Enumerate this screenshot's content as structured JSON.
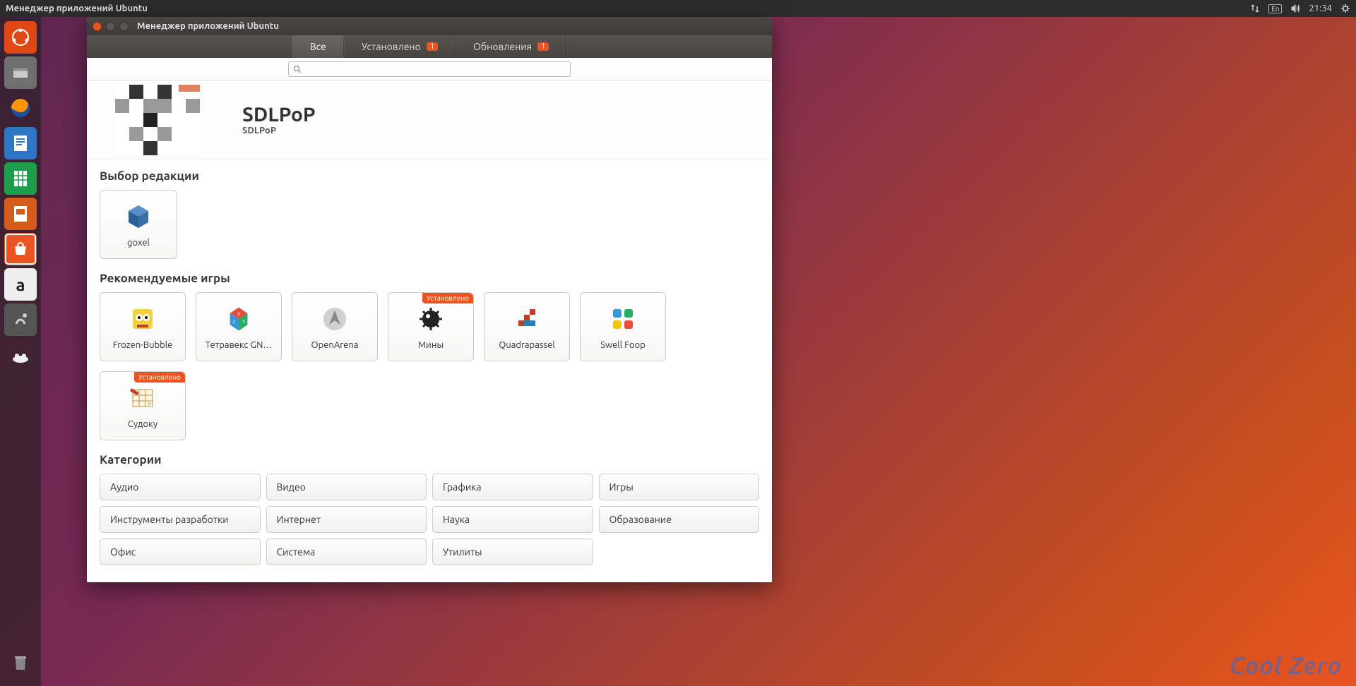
{
  "topbar": {
    "title": "Менеджер приложений Ubuntu",
    "lang": "En",
    "time": "21:34"
  },
  "window": {
    "title": "Менеджер приложений Ubuntu",
    "tabs": [
      {
        "label": "Все",
        "badge": ""
      },
      {
        "label": "Установлено",
        "badge": "1"
      },
      {
        "label": "Обновления",
        "badge": "1"
      }
    ]
  },
  "banner": {
    "title": "SDLPoP",
    "subtitle": "SDLPoP"
  },
  "editors": {
    "heading": "Выбор редакции",
    "items": [
      {
        "label": "goxel"
      }
    ]
  },
  "recommended": {
    "heading": "Рекомендуемые игры",
    "installed_label": "Установлено",
    "items": [
      {
        "label": "Frozen-Bubble",
        "installed": false
      },
      {
        "label": "Тетравекс GN…",
        "installed": false
      },
      {
        "label": "OpenArena",
        "installed": false
      },
      {
        "label": "Мины",
        "installed": true
      },
      {
        "label": "Quadrapassel",
        "installed": false
      },
      {
        "label": "Swell Foop",
        "installed": false
      },
      {
        "label": "Судоку",
        "installed": true
      }
    ]
  },
  "categories": {
    "heading": "Категории",
    "items": [
      "Аудио",
      "Видео",
      "Графика",
      "Игры",
      "Инструменты разработки",
      "Интернет",
      "Наука",
      "Образование",
      "Офис",
      "Система",
      "Утилиты"
    ]
  },
  "watermark": "Cool Zero"
}
